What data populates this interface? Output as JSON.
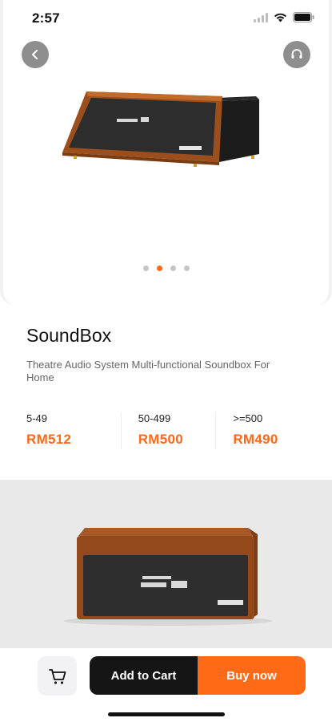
{
  "status_bar": {
    "time": "2:57",
    "icons": [
      "cellular-signal-icon",
      "wifi-icon",
      "battery-icon"
    ]
  },
  "header": {
    "back_icon": "chevron-left-icon",
    "support_icon": "headset-icon"
  },
  "gallery": {
    "image_count": 4,
    "active_index": 1,
    "accent_color": "#ff6a16"
  },
  "product": {
    "title": "SoundBox",
    "description": "Theatre Audio System Multi-functional Soundbox For Home",
    "price_tiers": [
      {
        "qty": "5-49",
        "price": "RM512"
      },
      {
        "qty": "50-499",
        "price": "RM500"
      },
      {
        "qty": ">=500",
        "price": "RM490"
      }
    ]
  },
  "actions": {
    "cart_icon": "cart-icon",
    "add_to_cart": "Add to Cart",
    "buy_now": "Buy now"
  },
  "colors": {
    "accent": "#ff6a16",
    "dark_button": "#151515"
  }
}
